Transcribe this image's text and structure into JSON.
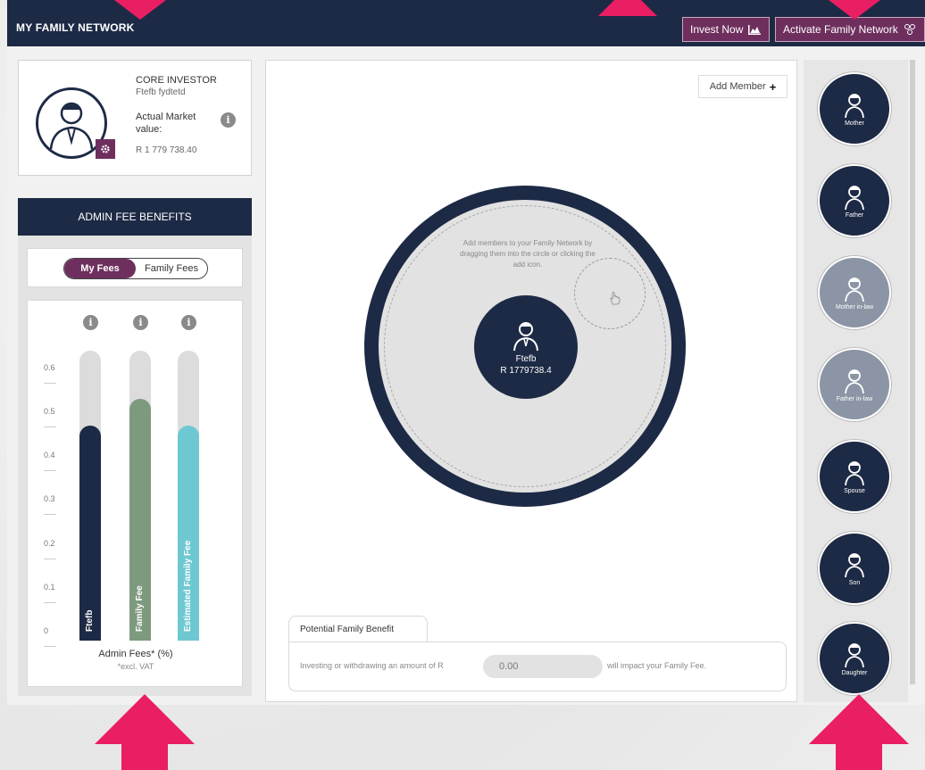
{
  "header": {
    "title": "MY FAMILY NETWORK",
    "invest_label": "Invest Now",
    "activate_label": "Activate Family Network"
  },
  "profile": {
    "role": "CORE INVESTOR",
    "name": "Ftefb fydtetd",
    "amv_label": "Actual Market value:",
    "amv_value": "R 1 779 738.40"
  },
  "admin": {
    "title": "ADMIN FEE BENEFITS",
    "toggle": [
      "My Fees",
      "Family Fees"
    ],
    "selected": "My Fees"
  },
  "chart_data": {
    "type": "bar",
    "categories": [
      "Ftefb",
      "Family Fee",
      "Estimated Family Fee"
    ],
    "values": [
      0.49,
      0.55,
      0.49
    ],
    "colors": [
      "#1d2a45",
      "#7d9a7e",
      "#6ec8d1"
    ],
    "xlabel": "Admin Fees* (%)",
    "xlabel_note": "*excl. VAT",
    "yticks": [
      "0.6",
      "0.5",
      "0.4",
      "0.3",
      "0.2",
      "0.1",
      "0"
    ],
    "ylim": [
      0,
      0.66
    ]
  },
  "main": {
    "add_member_label": "Add Member",
    "helper_text": "Add members to your Family Network by dragging them into the circle or clicking the add icon.",
    "core_name": "Ftefb",
    "core_value": "R 1779738.4",
    "pfb_tab": "Potential Family Benefit",
    "pfb_text_before": "Investing or withdrawing an amount of R",
    "pfb_input_value": "0.00",
    "pfb_text_after": "will impact your Family Fee."
  },
  "members": [
    {
      "label": "Mother",
      "enabled": true
    },
    {
      "label": "Father",
      "enabled": true
    },
    {
      "label": "Mother in-law",
      "enabled": false
    },
    {
      "label": "Father in-law",
      "enabled": false
    },
    {
      "label": "Spouse",
      "enabled": true
    },
    {
      "label": "Son",
      "enabled": true
    },
    {
      "label": "Daughter",
      "enabled": true
    }
  ],
  "colors": {
    "navy": "#1d2a45",
    "plum": "#6e2f5e",
    "arrow": "#e91e63"
  }
}
